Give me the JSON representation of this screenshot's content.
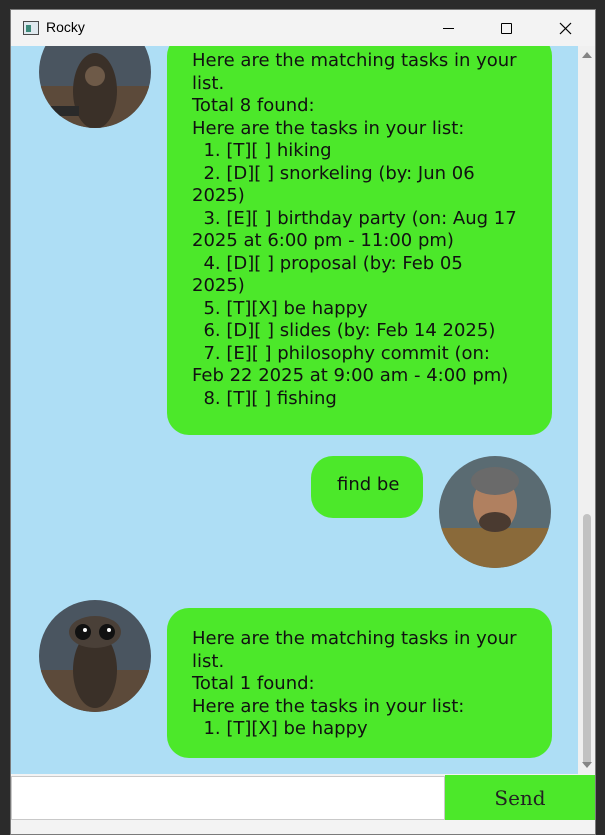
{
  "window": {
    "title": "Rocky"
  },
  "messages": [
    {
      "sender": "bot",
      "lines": [
        "Here are the matching tasks in your",
        "list.",
        "Total 8 found:",
        "Here are the tasks in your list:",
        "  1. [T][ ] hiking",
        "  2. [D][ ] snorkeling (by: Jun 06",
        "2025)",
        "  3. [E][ ] birthday party (on: Aug 17",
        "2025 at 6:00 pm - 11:00 pm)",
        "  4. [D][ ] proposal (by: Feb 05",
        "2025)",
        "  5. [T][X] be happy",
        "  6. [D][ ] slides (by: Feb 14 2025)",
        "  7. [E][ ] philosophy commit (on:",
        "Feb 22 2025 at 9:00 am - 4:00 pm)",
        "  8. [T][ ] fishing"
      ]
    },
    {
      "sender": "user",
      "lines": [
        "find be"
      ]
    },
    {
      "sender": "bot",
      "lines": [
        "Here are the matching tasks in your",
        "list.",
        "Total 1 found:",
        "Here are the tasks in your list:",
        "  1. [T][X] be happy"
      ]
    }
  ],
  "input": {
    "value": "",
    "placeholder": ""
  },
  "send_label": "Send",
  "colors": {
    "bubble": "#4ce82a",
    "chat_bg": "#aedef5",
    "send": "#4ce82a"
  }
}
